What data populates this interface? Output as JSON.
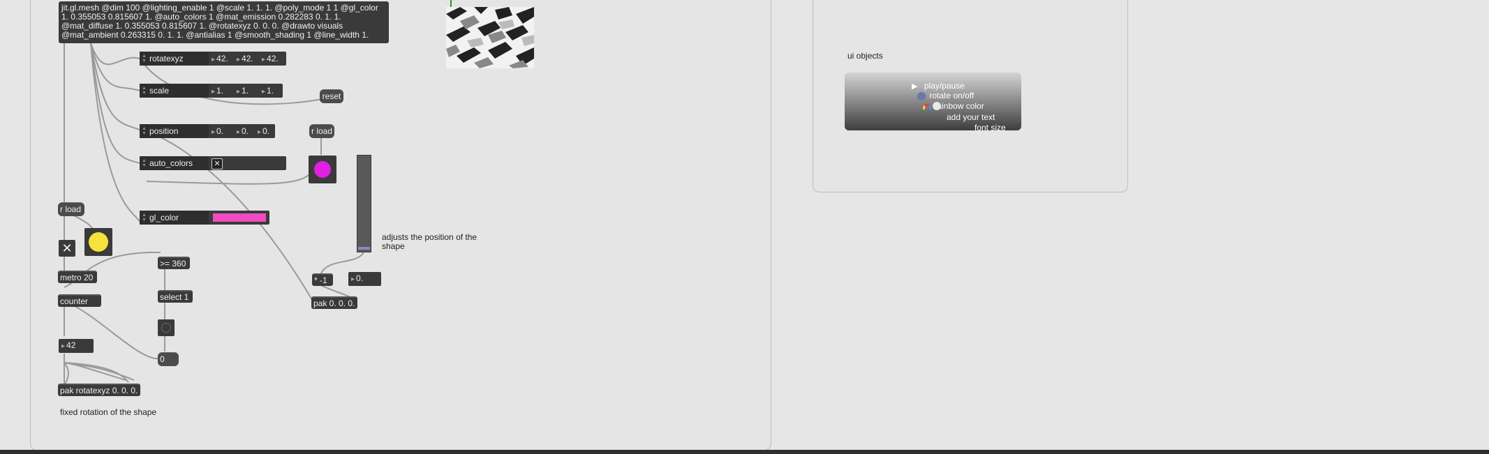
{
  "main_object": {
    "text": "jit.gl.mesh @dim 100 @lighting_enable 1 @scale 1. 1. 1. @poly_mode 1 1 @gl_color 1. 0.355053 0.815607 1. @auto_colors 1 @mat_emission 0.282283 0. 1. 1. @mat_diffuse 1. 0.355053 0.815607 1. @rotatexyz 0. 0. 0. @drawto visuals @mat_ambient 0.263315 0. 1. 1. @antialias 1 @smooth_shading 1 @line_width 1."
  },
  "attrui": {
    "rotatexyz": {
      "name": "rotatexyz",
      "values": [
        "42.",
        "42.",
        "42."
      ]
    },
    "scale": {
      "name": "scale",
      "values": [
        "1.",
        "1.",
        "1."
      ]
    },
    "position": {
      "name": "position",
      "values": [
        "0.",
        "0.",
        "0."
      ]
    },
    "auto_colors": {
      "name": "auto_colors",
      "checkbox": "✕"
    },
    "gl_color": {
      "name": "gl_color",
      "swatch_color": "#f04cc0"
    }
  },
  "messages": {
    "reset": "reset",
    "r_load_right": "r load",
    "r_load_left": "r load",
    "zero": "0"
  },
  "objects": {
    "metro": "metro 20",
    "counter": "counter",
    "gte": ">= 360",
    "select": "select 1",
    "mult": "* -1",
    "pak_pos": "pak 0. 0. 0.",
    "pak_rot": "pak rotatexyz 0. 0. 0."
  },
  "numbers": {
    "counter_value": "42",
    "mult_value": "0."
  },
  "labels": {
    "position_comment": "adjusts the position of the shape",
    "rotation_comment": "fixed rotation of the shape",
    "ui_title": "ui objects"
  },
  "ui_panel": {
    "items": [
      "play/pause",
      "rotate on/off",
      "rainbow color",
      "add your text",
      "font size"
    ]
  },
  "toggle": {
    "glyph": "✕"
  },
  "colors": {
    "accent_magenta": "#e020e0",
    "accent_yellow": "#f5e23a",
    "slider_thumb": "#8b86c8"
  }
}
